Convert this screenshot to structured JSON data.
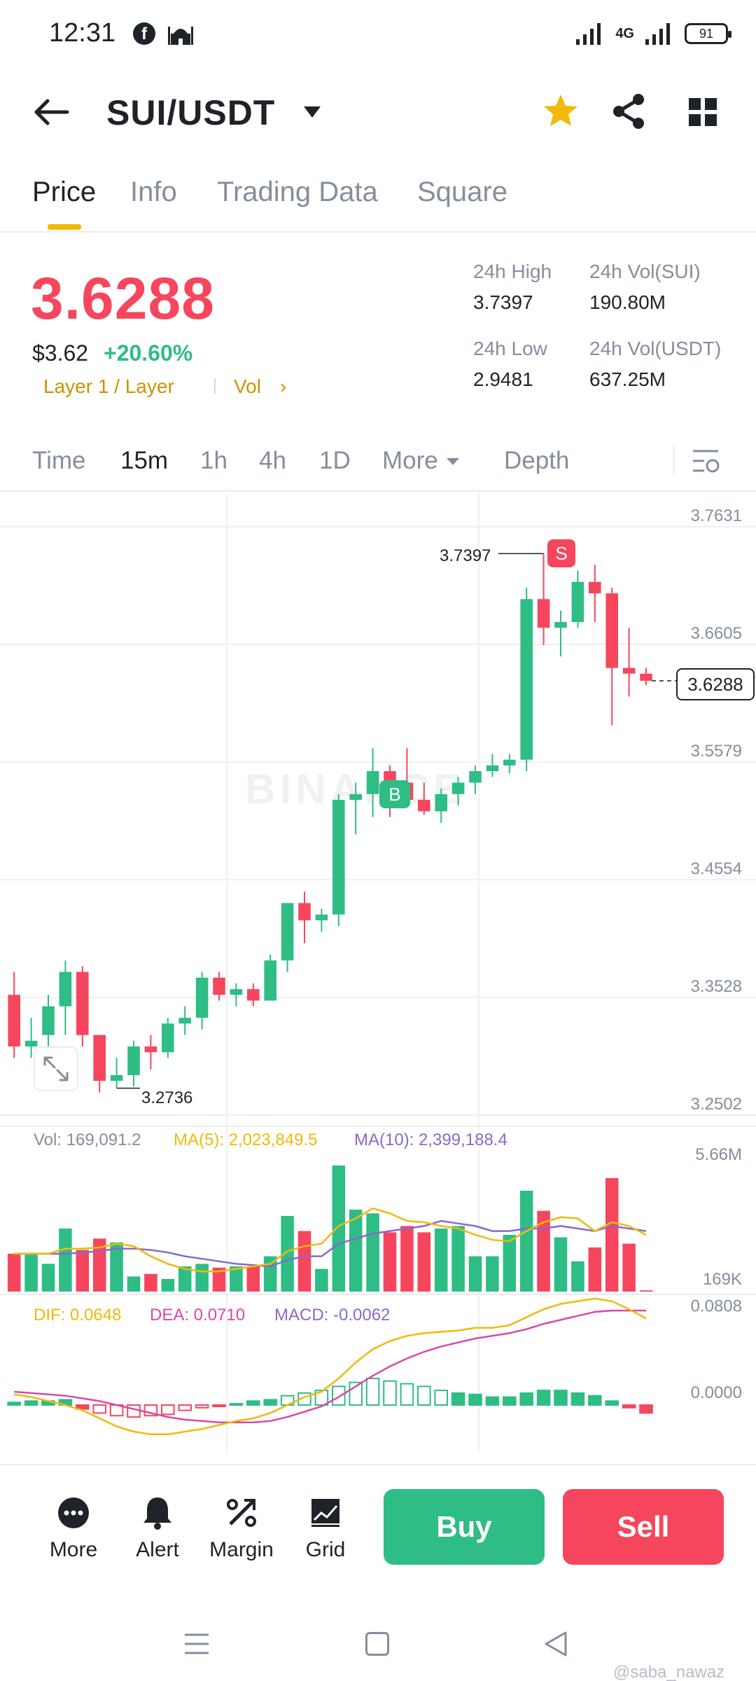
{
  "status_bar": {
    "time": "12:31",
    "network": "4G",
    "battery": "91"
  },
  "header": {
    "pair": "SUI/USDT"
  },
  "tabs": [
    "Price",
    "Info",
    "Trading Data",
    "Square"
  ],
  "price": {
    "last": "3.6288",
    "usd": "$3.62",
    "change": "+20.60%",
    "tag": "Layer 1 / Layer",
    "vol_link": "Vol",
    "chevron": "›"
  },
  "stats": {
    "high_label": "24h High",
    "high": "3.7397",
    "low_label": "24h Low",
    "low": "2.9481",
    "vol_sui_label": "24h Vol(SUI)",
    "vol_sui": "190.80M",
    "vol_usdt_label": "24h Vol(USDT)",
    "vol_usdt": "637.25M"
  },
  "intervals": [
    "Time",
    "15m",
    "1h",
    "4h",
    "1D",
    "More",
    "Depth"
  ],
  "chart": {
    "watermark": "BINANCE",
    "high_annotation": "3.7397",
    "low_annotation": "3.2736",
    "current_price": "3.6288",
    "buy_marker": "B",
    "sell_marker": "S",
    "price_axis": [
      "3.7631",
      "3.6605",
      "3.5579",
      "3.4554",
      "3.3528",
      "3.2502"
    ],
    "vol_axis": [
      "5.66M",
      "169K"
    ],
    "macd_axis": [
      "0.0808",
      "0.0000"
    ],
    "vol_legend": {
      "vol": "Vol: 169,091.2",
      "ma5": "MA(5): 2,023,849.5",
      "ma10": "MA(10): 2,399,188.4"
    },
    "macd_legend": {
      "dif": "DIF: 0.0648",
      "dea": "DEA: 0.0710",
      "macd": "MACD: -0.0062"
    },
    "colors": {
      "up": "#2ebd85",
      "down": "#f6465d",
      "ma5": "#f0b90b",
      "ma10": "#8c68c8",
      "dea": "#d948a8"
    }
  },
  "chart_data": {
    "type": "candlestick",
    "interval": "15m",
    "ylim": [
      3.2502,
      3.7631
    ],
    "candles": [
      {
        "o": 3.355,
        "h": 3.375,
        "l": 3.3,
        "c": 3.31
      },
      {
        "o": 3.31,
        "h": 3.335,
        "l": 3.3,
        "c": 3.315
      },
      {
        "o": 3.32,
        "h": 3.355,
        "l": 3.3,
        "c": 3.345
      },
      {
        "o": 3.345,
        "h": 3.385,
        "l": 3.32,
        "c": 3.375
      },
      {
        "o": 3.375,
        "h": 3.38,
        "l": 3.31,
        "c": 3.32
      },
      {
        "o": 3.32,
        "h": 3.32,
        "l": 3.27,
        "c": 3.28
      },
      {
        "o": 3.28,
        "h": 3.3,
        "l": 3.2736,
        "c": 3.285
      },
      {
        "o": 3.285,
        "h": 3.315,
        "l": 3.275,
        "c": 3.31
      },
      {
        "o": 3.31,
        "h": 3.32,
        "l": 3.29,
        "c": 3.305
      },
      {
        "o": 3.305,
        "h": 3.335,
        "l": 3.3,
        "c": 3.33
      },
      {
        "o": 3.33,
        "h": 3.345,
        "l": 3.32,
        "c": 3.335
      },
      {
        "o": 3.335,
        "h": 3.375,
        "l": 3.325,
        "c": 3.37
      },
      {
        "o": 3.37,
        "h": 3.375,
        "l": 3.35,
        "c": 3.355
      },
      {
        "o": 3.355,
        "h": 3.365,
        "l": 3.345,
        "c": 3.36
      },
      {
        "o": 3.36,
        "h": 3.365,
        "l": 3.345,
        "c": 3.35
      },
      {
        "o": 3.35,
        "h": 3.39,
        "l": 3.35,
        "c": 3.385
      },
      {
        "o": 3.385,
        "h": 3.435,
        "l": 3.375,
        "c": 3.435
      },
      {
        "o": 3.435,
        "h": 3.445,
        "l": 3.4,
        "c": 3.42
      },
      {
        "o": 3.42,
        "h": 3.43,
        "l": 3.41,
        "c": 3.425
      },
      {
        "o": 3.425,
        "h": 3.53,
        "l": 3.415,
        "c": 3.525
      },
      {
        "o": 3.525,
        "h": 3.54,
        "l": 3.495,
        "c": 3.53
      },
      {
        "o": 3.53,
        "h": 3.57,
        "l": 3.51,
        "c": 3.55
      },
      {
        "o": 3.55,
        "h": 3.555,
        "l": 3.51,
        "c": 3.54
      },
      {
        "o": 3.54,
        "h": 3.57,
        "l": 3.52,
        "c": 3.525
      },
      {
        "o": 3.525,
        "h": 3.54,
        "l": 3.512,
        "c": 3.515
      },
      {
        "o": 3.515,
        "h": 3.535,
        "l": 3.505,
        "c": 3.53
      },
      {
        "o": 3.53,
        "h": 3.545,
        "l": 3.52,
        "c": 3.54
      },
      {
        "o": 3.54,
        "h": 3.555,
        "l": 3.53,
        "c": 3.55
      },
      {
        "o": 3.55,
        "h": 3.565,
        "l": 3.545,
        "c": 3.555
      },
      {
        "o": 3.555,
        "h": 3.565,
        "l": 3.548,
        "c": 3.56
      },
      {
        "o": 3.56,
        "h": 3.71,
        "l": 3.55,
        "c": 3.7
      },
      {
        "o": 3.7,
        "h": 3.7397,
        "l": 3.66,
        "c": 3.675
      },
      {
        "o": 3.675,
        "h": 3.69,
        "l": 3.65,
        "c": 3.68
      },
      {
        "o": 3.68,
        "h": 3.725,
        "l": 3.675,
        "c": 3.715
      },
      {
        "o": 3.715,
        "h": 3.73,
        "l": 3.68,
        "c": 3.705
      },
      {
        "o": 3.705,
        "h": 3.71,
        "l": 3.59,
        "c": 3.64
      },
      {
        "o": 3.64,
        "h": 3.675,
        "l": 3.615,
        "c": 3.635
      },
      {
        "o": 3.635,
        "h": 3.64,
        "l": 3.625,
        "c": 3.6288
      }
    ],
    "volume": [
      0.3,
      0.3,
      0.22,
      0.5,
      0.33,
      0.42,
      0.39,
      0.12,
      0.14,
      0.1,
      0.2,
      0.22,
      0.19,
      0.2,
      0.2,
      0.28,
      0.6,
      0.48,
      0.18,
      1.0,
      0.65,
      0.62,
      0.47,
      0.52,
      0.47,
      0.5,
      0.52,
      0.28,
      0.28,
      0.45,
      0.8,
      0.64,
      0.43,
      0.24,
      0.35,
      0.9,
      0.38,
      0.01
    ],
    "ma5": [
      0.3,
      0.3,
      0.3,
      0.34,
      0.34,
      0.35,
      0.38,
      0.36,
      0.28,
      0.22,
      0.18,
      0.16,
      0.16,
      0.18,
      0.2,
      0.22,
      0.32,
      0.36,
      0.38,
      0.52,
      0.58,
      0.66,
      0.62,
      0.56,
      0.55,
      0.52,
      0.5,
      0.45,
      0.41,
      0.4,
      0.48,
      0.55,
      0.59,
      0.58,
      0.48,
      0.55,
      0.52,
      0.45
    ],
    "ma10": [
      0.3,
      0.3,
      0.3,
      0.3,
      0.31,
      0.32,
      0.34,
      0.34,
      0.33,
      0.31,
      0.28,
      0.26,
      0.24,
      0.22,
      0.21,
      0.2,
      0.25,
      0.28,
      0.28,
      0.38,
      0.42,
      0.46,
      0.48,
      0.5,
      0.52,
      0.56,
      0.54,
      0.52,
      0.48,
      0.48,
      0.5,
      0.5,
      0.52,
      0.5,
      0.48,
      0.52,
      0.5,
      0.48
    ],
    "macd": {
      "dif": [
        0.008,
        0.006,
        0.003,
        0.0,
        -0.004,
        -0.01,
        -0.016,
        -0.02,
        -0.022,
        -0.022,
        -0.02,
        -0.018,
        -0.015,
        -0.012,
        -0.01,
        -0.006,
        0.0,
        0.006,
        0.01,
        0.02,
        0.032,
        0.042,
        0.048,
        0.052,
        0.054,
        0.055,
        0.056,
        0.058,
        0.058,
        0.06,
        0.066,
        0.072,
        0.076,
        0.078,
        0.08,
        0.078,
        0.072,
        0.065
      ],
      "dea": [
        0.01,
        0.009,
        0.008,
        0.007,
        0.005,
        0.003,
        0.0,
        -0.003,
        -0.006,
        -0.009,
        -0.011,
        -0.012,
        -0.013,
        -0.013,
        -0.013,
        -0.012,
        -0.009,
        -0.005,
        -0.001,
        0.006,
        0.014,
        0.022,
        0.029,
        0.035,
        0.04,
        0.044,
        0.047,
        0.05,
        0.052,
        0.054,
        0.057,
        0.061,
        0.064,
        0.067,
        0.07,
        0.071,
        0.071,
        0.071
      ],
      "hist": [
        0.002,
        0.003,
        0.003,
        0.004,
        -0.003,
        -0.006,
        -0.008,
        -0.009,
        -0.008,
        -0.007,
        -0.004,
        -0.002,
        -0.001,
        0.001,
        0.003,
        0.004,
        0.007,
        0.009,
        0.011,
        0.014,
        0.017,
        0.02,
        0.018,
        0.016,
        0.014,
        0.011,
        0.009,
        0.008,
        0.006,
        0.006,
        0.009,
        0.011,
        0.011,
        0.009,
        0.007,
        0.003,
        -0.002,
        -0.006
      ]
    }
  },
  "actions": {
    "more": "More",
    "alert": "Alert",
    "margin": "Margin",
    "grid": "Grid",
    "buy": "Buy",
    "sell": "Sell"
  },
  "credit": "@saba_nawaz"
}
